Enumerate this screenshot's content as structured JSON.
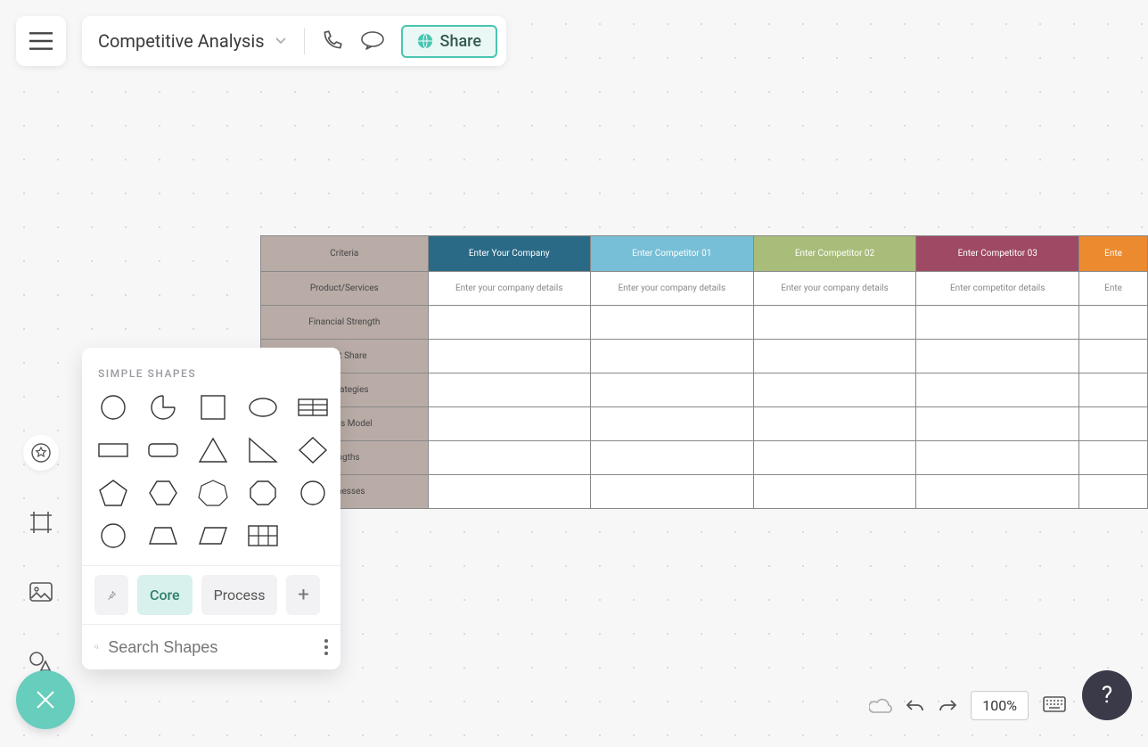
{
  "header": {
    "title": "Competitive Analysis",
    "share_label": "Share"
  },
  "shapes_panel": {
    "heading": "SIMPLE SHAPES",
    "tabs": {
      "core": "Core",
      "process": "Process"
    },
    "search_placeholder": "Search Shapes"
  },
  "table": {
    "headers": {
      "criteria": "Criteria",
      "company": "Enter Your Company",
      "comp1": "Enter Competitor 01",
      "comp2": "Enter Competitor 02",
      "comp3": "Enter Competitor 03",
      "comp4": "Ente"
    },
    "rows": {
      "r0": {
        "label": "Product/Services",
        "c0": "Enter your company details",
        "c1": "Enter your company details",
        "c2": "Enter your company details",
        "c3": "Enter competitor details",
        "c4": "Ente"
      },
      "r1": {
        "label": "Financial Strength"
      },
      "r2": {
        "label": "et Share"
      },
      "r3": {
        "label": "rategies"
      },
      "r4": {
        "label": "ess Model"
      },
      "r5": {
        "label": "engths"
      },
      "r6": {
        "label": "knesses"
      }
    }
  },
  "footer": {
    "zoom": "100%",
    "help": "?"
  }
}
